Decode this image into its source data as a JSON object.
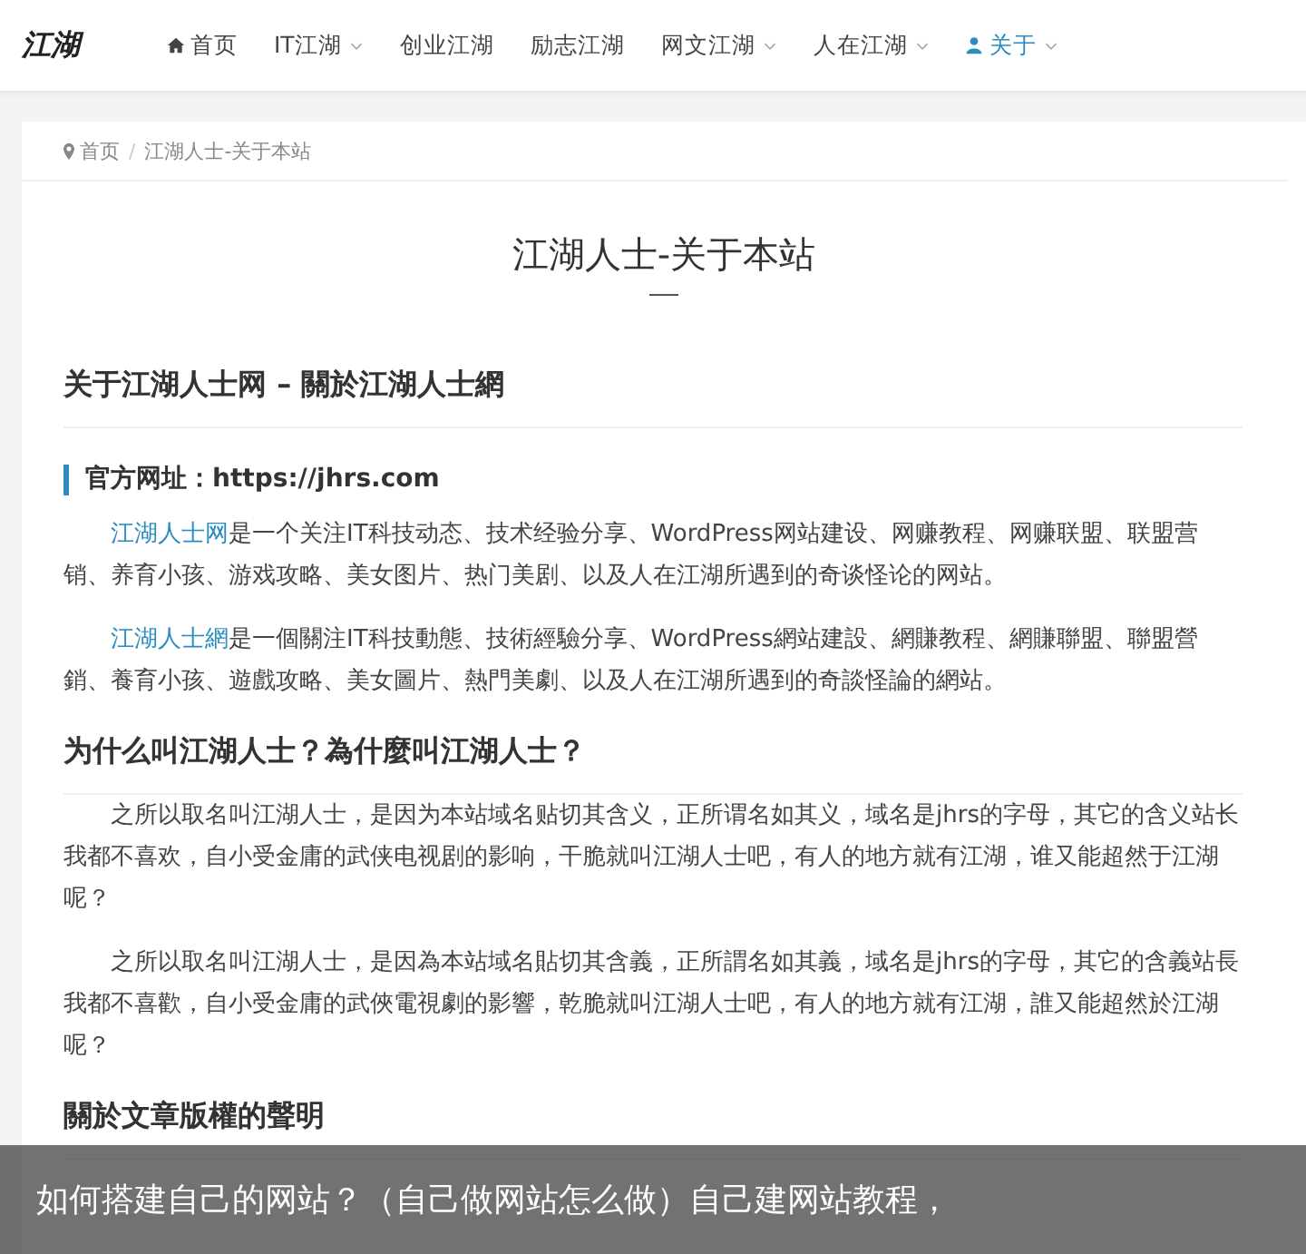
{
  "nav": {
    "logo": "江湖",
    "items": [
      {
        "label": "首页",
        "kind": "home",
        "caret": false,
        "selected": false
      },
      {
        "label": "IT江湖",
        "kind": "plain",
        "caret": true,
        "selected": false
      },
      {
        "label": "创业江湖",
        "kind": "plain",
        "caret": false,
        "selected": false
      },
      {
        "label": "励志江湖",
        "kind": "plain",
        "caret": false,
        "selected": false
      },
      {
        "label": "网文江湖",
        "kind": "plain",
        "caret": true,
        "selected": false
      },
      {
        "label": "人在江湖",
        "kind": "plain",
        "caret": true,
        "selected": false
      },
      {
        "label": "关于",
        "kind": "user",
        "caret": true,
        "selected": true
      }
    ]
  },
  "breadcrumb": [
    {
      "label": "首页",
      "kind": "link"
    },
    {
      "label": "/",
      "kind": "separator"
    },
    {
      "label": "江湖人士-关于本站",
      "kind": "current"
    }
  ],
  "page_title": "江湖人士-关于本站",
  "blocks": [
    {
      "kind": "heading",
      "text": "关于江湖人士网 – 關於江湖人士網"
    },
    {
      "kind": "subheading",
      "text": "官方网址：https://jhrs.com"
    },
    {
      "kind": "paragraph",
      "link": "江湖人士网",
      "text": "是一个关注IT科技动态、技术经验分享、WordPress网站建设、网赚教程、网赚联盟、联盟营销、养育小孩、游戏攻略、美女图片、热门美剧、以及人在江湖所遇到的奇谈怪论的网站。"
    },
    {
      "kind": "paragraph",
      "link": "江湖人士網",
      "text": "是一個關注IT科技動態、技術經驗分享、WordPress網站建設、網賺教程、網賺聯盟、聯盟營銷、養育小孩、遊戲攻略、美女圖片、熱門美劇、以及人在江湖所遇到的奇談怪論的網站。"
    },
    {
      "kind": "heading",
      "text": "为什么叫江湖人士？為什麼叫江湖人士？"
    },
    {
      "kind": "paragraph",
      "text": "之所以取名叫江湖人士，是因为本站域名贴切其含义，正所谓名如其义，域名是jhrs的字母，其它的含义站长我都不喜欢，自小受金庸的武侠电视剧的影响，干脆就叫江湖人士吧，有人的地方就有江湖，谁又能超然于江湖呢？"
    },
    {
      "kind": "paragraph",
      "text": "之所以取名叫江湖人士，是因為本站域名貼切其含義，正所謂名如其義，域名是jhrs的字母，其它的含義站長我都不喜歡，自小受金庸的武俠電視劇的影響，乾脆就叫江湖人士吧，有人的地方就有江湖，誰又能超然於江湖呢？"
    },
    {
      "kind": "heading",
      "text": "關於文章版權的聲明"
    }
  ],
  "caption": "如何搭建自己的网站？（自己做网站怎么做）自己建网站教程，"
}
